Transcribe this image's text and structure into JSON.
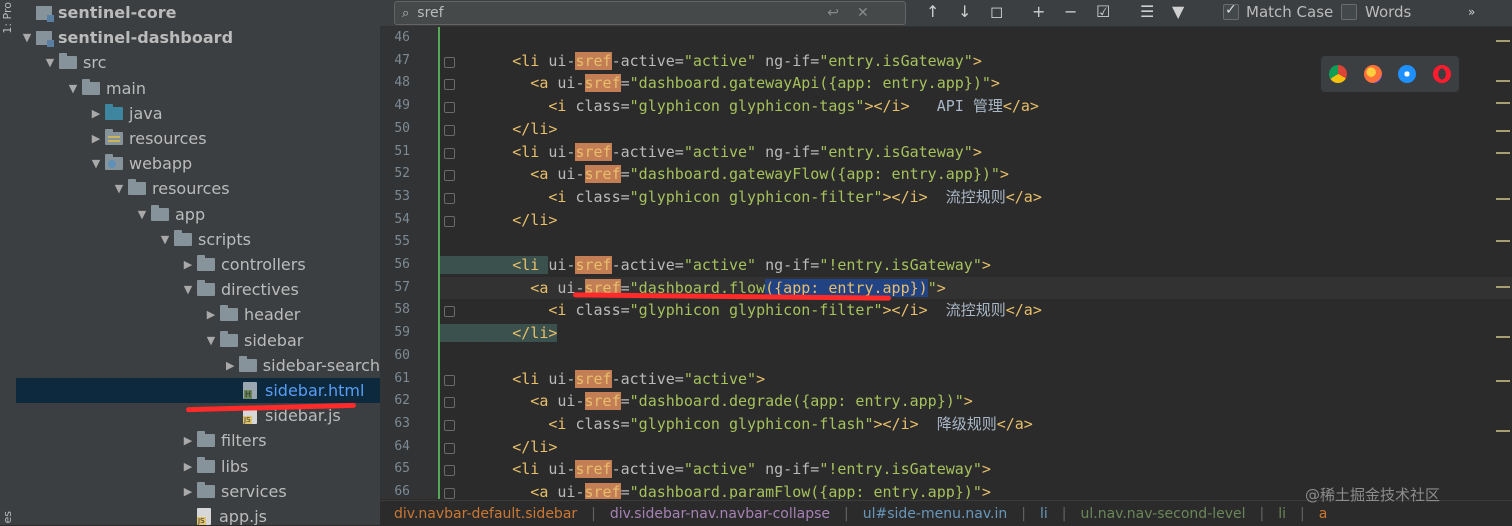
{
  "side_strip": {
    "top_label": "1: Pro",
    "bottom_label": "es"
  },
  "tree": [
    {
      "label": "sentinel-core",
      "level": 0,
      "arrow": "",
      "icon": "module",
      "bold": true
    },
    {
      "label": "sentinel-dashboard",
      "level": 0,
      "arrow": "▼",
      "icon": "module",
      "bold": true
    },
    {
      "label": "src",
      "level": 1,
      "arrow": "▼",
      "icon": "folder"
    },
    {
      "label": "main",
      "level": 2,
      "arrow": "▼",
      "icon": "folder"
    },
    {
      "label": "java",
      "level": 3,
      "arrow": "▶",
      "icon": "folder-blue"
    },
    {
      "label": "resources",
      "level": 3,
      "arrow": "▶",
      "icon": "folder-res"
    },
    {
      "label": "webapp",
      "level": 3,
      "arrow": "▼",
      "icon": "folder-web"
    },
    {
      "label": "resources",
      "level": 4,
      "arrow": "▼",
      "icon": "folder"
    },
    {
      "label": "app",
      "level": 5,
      "arrow": "▼",
      "icon": "folder"
    },
    {
      "label": "scripts",
      "level": 6,
      "arrow": "▼",
      "icon": "folder"
    },
    {
      "label": "controllers",
      "level": 7,
      "arrow": "▶",
      "icon": "folder"
    },
    {
      "label": "directives",
      "level": 7,
      "arrow": "▼",
      "icon": "folder"
    },
    {
      "label": "header",
      "level": 8,
      "arrow": "▶",
      "icon": "folder"
    },
    {
      "label": "sidebar",
      "level": 8,
      "arrow": "▼",
      "icon": "folder"
    },
    {
      "label": "sidebar-search",
      "level": 9,
      "arrow": "▶",
      "icon": "folder"
    },
    {
      "label": "sidebar.html",
      "level": 9,
      "arrow": "",
      "icon": "html",
      "selected": true
    },
    {
      "label": "sidebar.js",
      "level": 9,
      "arrow": "",
      "icon": "js"
    },
    {
      "label": "filters",
      "level": 7,
      "arrow": "▶",
      "icon": "folder"
    },
    {
      "label": "libs",
      "level": 7,
      "arrow": "▶",
      "icon": "folder"
    },
    {
      "label": "services",
      "level": 7,
      "arrow": "▶",
      "icon": "folder"
    },
    {
      "label": "app.js",
      "level": 7,
      "arrow": "",
      "icon": "js"
    }
  ],
  "search": {
    "value": "sref",
    "match_case_label": "Match Case",
    "words_label": "Words",
    "match_case_checked": true,
    "words_checked": false
  },
  "code_lines": [
    {
      "n": "46",
      "segs": []
    },
    {
      "n": "47",
      "segs": [
        [
          "lt",
          "        <li "
        ],
        [
          "attr",
          "ui-"
        ],
        [
          "hl",
          "sref"
        ],
        [
          "attr",
          "-active="
        ],
        [
          "val",
          "\"active\""
        ],
        [
          "attr",
          " ng-if="
        ],
        [
          "val",
          "\"entry.isGateway\""
        ],
        [
          "lt",
          ">"
        ]
      ]
    },
    {
      "n": "48",
      "segs": [
        [
          "lt",
          "          <a "
        ],
        [
          "attr",
          "ui-"
        ],
        [
          "hl",
          "sref"
        ],
        [
          "attr",
          "="
        ],
        [
          "val",
          "\"dashboard.gatewayApi({app: entry.app})\""
        ],
        [
          "lt",
          ">"
        ]
      ]
    },
    {
      "n": "49",
      "segs": [
        [
          "lt",
          "            <i "
        ],
        [
          "attr",
          "class="
        ],
        [
          "val",
          "\"glyphicon glyphicon-tags\""
        ],
        [
          "lt",
          "></i>"
        ],
        [
          "txt",
          "   API 管理"
        ],
        [
          "lt",
          "</a>"
        ]
      ]
    },
    {
      "n": "50",
      "segs": [
        [
          "lt",
          "        </li>"
        ]
      ]
    },
    {
      "n": "51",
      "segs": [
        [
          "lt",
          "        <li "
        ],
        [
          "attr",
          "ui-"
        ],
        [
          "hl",
          "sref"
        ],
        [
          "attr",
          "-active="
        ],
        [
          "val",
          "\"active\""
        ],
        [
          "attr",
          " ng-if="
        ],
        [
          "val",
          "\"entry.isGateway\""
        ],
        [
          "lt",
          ">"
        ]
      ]
    },
    {
      "n": "52",
      "segs": [
        [
          "lt",
          "          <a "
        ],
        [
          "attr",
          "ui-"
        ],
        [
          "hl",
          "sref"
        ],
        [
          "attr",
          "="
        ],
        [
          "val",
          "\"dashboard.gatewayFlow({app: entry.app})\""
        ],
        [
          "lt",
          ">"
        ]
      ]
    },
    {
      "n": "53",
      "segs": [
        [
          "lt",
          "            <i "
        ],
        [
          "attr",
          "class="
        ],
        [
          "val",
          "\"glyphicon glyphicon-filter\""
        ],
        [
          "lt",
          "></i>"
        ],
        [
          "txt",
          "  流控规则"
        ],
        [
          "lt",
          "</a>"
        ]
      ]
    },
    {
      "n": "54",
      "segs": [
        [
          "lt",
          "        </li>"
        ]
      ]
    },
    {
      "n": "55",
      "segs": []
    },
    {
      "n": "56",
      "segs": [
        [
          "tag-soft",
          "        <li "
        ],
        [
          "attr",
          "ui-"
        ],
        [
          "hl",
          "sref"
        ],
        [
          "attr",
          "-active="
        ],
        [
          "val",
          "\"active\""
        ],
        [
          "attr",
          " ng-if="
        ],
        [
          "val",
          "\"!entry.isGateway\""
        ],
        [
          "lt",
          ">"
        ]
      ]
    },
    {
      "n": "57",
      "current": true,
      "segs": [
        [
          "lt",
          "          <a "
        ],
        [
          "attr",
          "ui-"
        ],
        [
          "hl",
          "sref"
        ],
        [
          "attr",
          "="
        ],
        [
          "val",
          "\"dashboard.flow"
        ],
        [
          "hlval",
          "({app: entry.app})"
        ],
        [
          "val",
          "\""
        ],
        [
          "lt",
          ">"
        ]
      ]
    },
    {
      "n": "58",
      "segs": [
        [
          "lt",
          "            <i "
        ],
        [
          "attr",
          "class="
        ],
        [
          "val",
          "\"glyphicon glyphicon-filter\""
        ],
        [
          "lt",
          "></i>"
        ],
        [
          "txt",
          "  流控规则"
        ],
        [
          "lt",
          "</a>"
        ]
      ]
    },
    {
      "n": "59",
      "segs": [
        [
          "tag-soft",
          "        </li>"
        ]
      ]
    },
    {
      "n": "60",
      "segs": []
    },
    {
      "n": "61",
      "segs": [
        [
          "lt",
          "        <li "
        ],
        [
          "attr",
          "ui-"
        ],
        [
          "hl",
          "sref"
        ],
        [
          "attr",
          "-active="
        ],
        [
          "val",
          "\"active\""
        ],
        [
          "lt",
          ">"
        ]
      ]
    },
    {
      "n": "62",
      "segs": [
        [
          "lt",
          "          <a "
        ],
        [
          "attr",
          "ui-"
        ],
        [
          "hl",
          "sref"
        ],
        [
          "attr",
          "="
        ],
        [
          "val",
          "\"dashboard.degrade({app: entry.app})\""
        ],
        [
          "lt",
          ">"
        ]
      ]
    },
    {
      "n": "63",
      "segs": [
        [
          "lt",
          "            <i "
        ],
        [
          "attr",
          "class="
        ],
        [
          "val",
          "\"glyphicon glyphicon-flash\""
        ],
        [
          "lt",
          "></i>"
        ],
        [
          "txt",
          "  降级规则"
        ],
        [
          "lt",
          "</a>"
        ]
      ]
    },
    {
      "n": "64",
      "segs": [
        [
          "lt",
          "        </li>"
        ]
      ]
    },
    {
      "n": "65",
      "segs": [
        [
          "lt",
          "        <li "
        ],
        [
          "attr",
          "ui-"
        ],
        [
          "hl",
          "sref"
        ],
        [
          "attr",
          "-active="
        ],
        [
          "val",
          "\"active\""
        ],
        [
          "attr",
          " ng-if="
        ],
        [
          "val",
          "\"!entry.isGateway\""
        ],
        [
          "lt",
          ">"
        ]
      ]
    },
    {
      "n": "66",
      "segs": [
        [
          "lt",
          "          <a "
        ],
        [
          "attr",
          "ui-"
        ],
        [
          "hl",
          "sref"
        ],
        [
          "attr",
          "="
        ],
        [
          "val",
          "\"dashboard.paramFlow({app: entry.app})\""
        ],
        [
          "lt",
          ">"
        ]
      ]
    }
  ],
  "breadcrumbs": [
    {
      "label": "div.navbar-default.sidebar",
      "style": "orange"
    },
    {
      "label": "div.sidebar-nav.navbar-collapse",
      "style": "purple"
    },
    {
      "label": "ul#side-menu.nav.in",
      "style": "blue"
    },
    {
      "label": "li",
      "style": "blue"
    },
    {
      "label": "ul.nav.nav-second-level",
      "style": "green"
    },
    {
      "label": "li",
      "style": "green"
    },
    {
      "label": "a",
      "style": "orange"
    }
  ],
  "watermark": "@稀土掘金技术社区",
  "colors": {
    "chrome": "#4285f4",
    "firefox": "#ff7139",
    "safari": "#1e90ff",
    "opera": "#ff1b2d",
    "annotation": "#ff2a2a"
  }
}
